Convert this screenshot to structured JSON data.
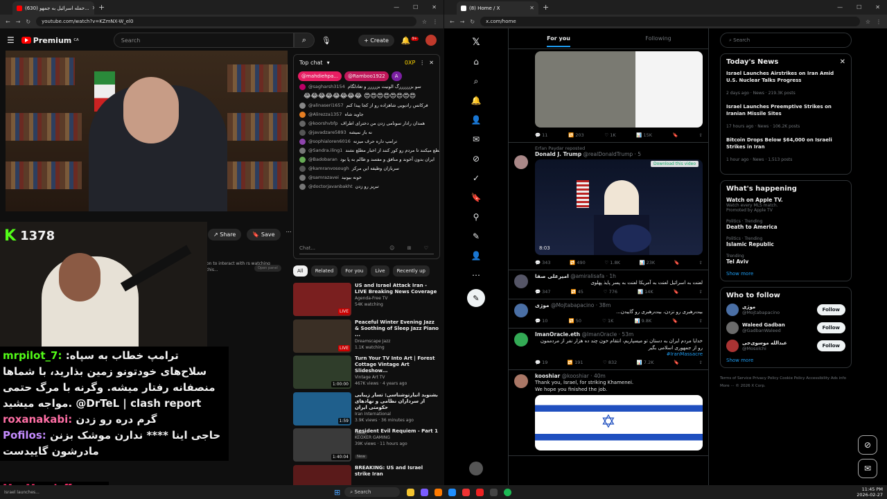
{
  "left": {
    "tab_title": "(630) حمله اسرائیل به جمهو...",
    "url": "youtube.com/watch?v=KZmNX-W_el0",
    "logo": "Premium",
    "logo_cc": "CA",
    "search_placeholder": "Search",
    "create_label": "Create",
    "notif_count": "9+",
    "share_label": "Share",
    "save_label": "Save",
    "kick_viewers": "1378",
    "overlay_hint": "on to interact with rs watching this...",
    "overlay_btn": "Open panel",
    "chat": {
      "header": "Top chat",
      "points": "0XP",
      "tickers": [
        "@mahdiehpa...",
        "@Ramboo1922",
        "A"
      ],
      "messages": [
        {
          "user": "@sagharsh3154",
          "text": "سو بزرررررگ الونیت بزرررر و تعادلگام",
          "color": "#b06"
        },
        {
          "user": "@alinaseri1657",
          "text": "فرکانس رادیویی شاهزاده رو از کجا پیدا کنم",
          "color": "#888"
        },
        {
          "user": "@Alirezza1357",
          "text": "جاوید شاه",
          "color": "#e67e22"
        },
        {
          "user": "@koorshvbfp",
          "text": "همدان رادار سونامی زدن من دخترای اطراف",
          "color": "#666"
        },
        {
          "user": "@javadzare5893",
          "text": "نه باز نمیشه",
          "color": "#555"
        },
        {
          "user": "@sophialoren6016",
          "text": "ترامپ داره حرف میزنه",
          "color": "#8e44ad"
        },
        {
          "user": "@Sandra.iling1",
          "text": "دن رو قطع میکنند تا مردم رو کور کنند از اخبار مطلع نشند",
          "color": "#777"
        },
        {
          "user": "@Badobaran",
          "text": "ایران بدون آخوند و منافق و مفسد و ظالم به پا بود",
          "color": "#6a5"
        },
        {
          "user": "@kamranvosough",
          "text": "سربازان وظیفه این مرکز",
          "color": "#555"
        },
        {
          "user": "@samrazavei",
          "text": "خونه بیونید",
          "color": "#777"
        },
        {
          "user": "@doctorjavanbakht",
          "text": "تبریز رو زدن",
          "color": "#777"
        }
      ],
      "emoji_row": "😂😂😂😂😂😂😂😂 😍😍😍😍😍😍😍😍",
      "input_placeholder": "Chat..."
    },
    "chips": [
      "All",
      "Related",
      "For you",
      "Live",
      "Recently up"
    ],
    "recs": [
      {
        "title": "US and Israel Attack Iran - LIVE Breaking News Coverage",
        "channel": "Agenda-Free TV",
        "meta": "54K watching",
        "badge": "LIVE",
        "thumb": "#7a1f1f",
        "live": true
      },
      {
        "title": "Peaceful Winter Evening Jazz & Soothing of Sleep Jazz Piano ...",
        "channel": "Dreamscape Jazz",
        "meta": "1.1K watching",
        "badge": "LIVE",
        "thumb": "#3a2f25",
        "live": true
      },
      {
        "title": "Turn Your TV Into Art | Forest Cottage Vintage Art Slideshow...",
        "channel": "Vintage Art TV",
        "meta": "467K views · 4 years ago",
        "badge": "1:00:00",
        "thumb": "#2f3d2a",
        "live": false
      },
      {
        "title": "بشنوید انبارتوشناسی: تسار زیبایی از سرداران نظامی و نهادهای حکومتی ایران",
        "channel": "Iran International",
        "meta": "3.9K views · 36 minutes ago",
        "badge": "1:59",
        "thumb": "#1f5f8c",
        "live": false,
        "new": "New"
      },
      {
        "title": "Resident Evil Requiem - Part 1",
        "channel": "KEOXER GAMING",
        "meta": "39K views · 11 hours ago",
        "badge": "1:40:04",
        "thumb": "#3a3a3a",
        "live": false,
        "new": "New"
      },
      {
        "title": "BREAKING: US and Israel strike Iran",
        "channel": "",
        "meta": "",
        "badge": "",
        "thumb": "#5a1a1a",
        "live": false
      }
    ],
    "stream_chat": [
      {
        "user": "mrpilot_7:",
        "text": "ترامپ خطاب به سپاه: سلاح‌های خودتونو زمین بذارید، با شماها منصفانه رفتار میشه. وگرنه با مرگ حتمی مواجه میشید.",
        "extra": "@DrTeL | clash report",
        "ucolor": "#53fc18"
      },
      {
        "user": "roxanakabi:",
        "text": "گرم دره رو زدن",
        "extra": "",
        "ucolor": "#ff6fa5"
      },
      {
        "user": "Pofilos:",
        "text": "حاجی اینا **** ندارن موشک بزنن مادرشون گاییدست",
        "extra": "",
        "ucolor": "#c58cff"
      }
    ],
    "bottom_user": "MooMoo_Jefferson:"
  },
  "right": {
    "tab_title": "(8) Home / X",
    "url": "x.com/home",
    "tabs": [
      "For you",
      "Following"
    ],
    "search_placeholder": "Search",
    "tweets": [
      {
        "stats": [
          "11",
          "203",
          "1K",
          "15K"
        ]
      },
      {
        "repost": "Erfan Paydar reposted",
        "name": "Donald J. Trump",
        "handle": "@realDonaldTrump · 5",
        "text": "",
        "dl": "Download this video",
        "duration": "8:03",
        "stats": [
          "343",
          "490",
          "1.8K",
          "23K"
        ]
      },
      {
        "name": "امیرعلی صفا",
        "handle": "@amiralisafa · 1h",
        "text": "لعنت به اسرائیل لعنت به آمریکا لعنت به پسر پایذ پهلوی",
        "stats": [
          "347",
          "45",
          "776",
          "14K"
        ]
      },
      {
        "name": "موژی",
        "handle": "@Mojtabapacino · 38m",
        "text": "بیت‌رهبری رو نزدن، بیت‌رهبری رو گاییدن...",
        "stats": [
          "10",
          "50",
          "1K",
          "9.8K"
        ]
      },
      {
        "name": "ImanOracle.eth",
        "handle": "@ImanOracle · 53m",
        "text": "خدایا مردم ایران به دستان تو میسپاریم، انتقام خون چند ده هزار نفر از مردممون رو از جمهوری اسلامی بگیر",
        "link": "#IranMassacre",
        "stats": [
          "19",
          "191",
          "832",
          "7.2K"
        ]
      },
      {
        "name": "kooshiar",
        "handle": "@kooshiar · 40m",
        "text": "Thank you, Israel, for striking Khamenei.\nWe hope you finished the job.",
        "stats": []
      }
    ],
    "news_title": "Today's News",
    "news": [
      {
        "title": "Israel Launches Airstrikes on Iran Amid U.S. Nuclear Talks Progress",
        "meta": "2 days ago · News · 219.3K posts"
      },
      {
        "title": "Israel Launches Preemptive Strikes on Iranian Missile Sites",
        "meta": "17 hours ago · News · 106.2K posts"
      },
      {
        "title": "Bitcoin Drops Below $64,000 on Israeli Strikes in Iran",
        "meta": "1 hour ago · News · 1,513 posts"
      }
    ],
    "happening_title": "What's happening",
    "trends": [
      {
        "cat": "",
        "title": "Watch on Apple TV.",
        "sub": "Watch every MLS match.",
        "promo": "Promoted by Apple TV"
      },
      {
        "cat": "Politics · Trending",
        "title": "Death to America",
        "sub": "",
        "promo": ""
      },
      {
        "cat": "Politics · Trending",
        "title": "Islamic Republic",
        "sub": "",
        "promo": ""
      },
      {
        "cat": "Trending",
        "title": "Tel Aviv",
        "sub": "",
        "promo": ""
      }
    ],
    "show_more": "Show more",
    "wtf_title": "Who to follow",
    "wtf": [
      {
        "name": "موژی",
        "handle": "@Mojtabapacino",
        "btn": "Follow",
        "color": "#4a6fa5"
      },
      {
        "name": "Waleed Gadban",
        "handle": "@GadbanWaleed",
        "btn": "Follow",
        "color": "#6b6b6b"
      },
      {
        "name": "عبدالله موسوی‌جی",
        "handle": "@Mosolchi",
        "btn": "Follow",
        "color": "#a33"
      }
    ],
    "footer": "Terms of Service   Privacy Policy   Cookie Policy   Accessibility   Ads info   More ···   © 2026 X Corp."
  },
  "taskbar": {
    "search": "Search",
    "time": "11:45 PM",
    "date": "2026-02-27",
    "weather": "Israel launches..."
  }
}
